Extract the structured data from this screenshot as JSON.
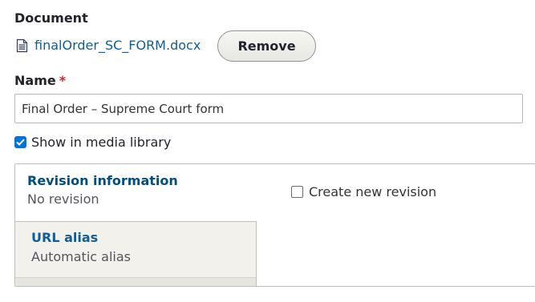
{
  "document": {
    "label": "Document",
    "file_name": "finalOrder_SC_FORM.docx",
    "remove_label": "Remove"
  },
  "name": {
    "label": "Name",
    "required_mark": "*",
    "value": "Final Order – Supreme Court form"
  },
  "media_library": {
    "label": "Show in media library",
    "checked": true
  },
  "tabs": {
    "revision": {
      "title": "Revision information",
      "summary": "No revision"
    },
    "url_alias": {
      "title": "URL alias",
      "summary": "Automatic alias"
    }
  },
  "revision": {
    "label": "Create new revision",
    "checked": false
  },
  "colors": {
    "link": "#0f5e97",
    "required": "#dc2323",
    "checkbox_accent": "#0073d9",
    "inactive_tab_bg": "#f2f1eb"
  }
}
